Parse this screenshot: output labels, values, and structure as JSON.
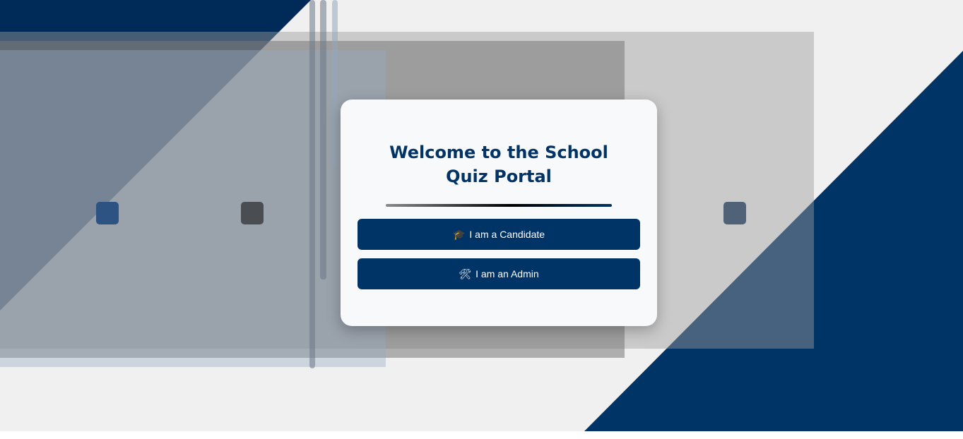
{
  "card": {
    "title": "Welcome to the School Quiz Portal"
  },
  "buttons": {
    "candidate": {
      "icon": "🎓",
      "icon_name": "graduation-cap-icon",
      "label": "I am a Candidate"
    },
    "admin": {
      "icon": "🛠",
      "icon_name": "tools-icon",
      "label": "I am an Admin"
    }
  },
  "colors": {
    "primary": "#003366",
    "background": "#f0f0f0",
    "card": "#f8f9fa"
  }
}
